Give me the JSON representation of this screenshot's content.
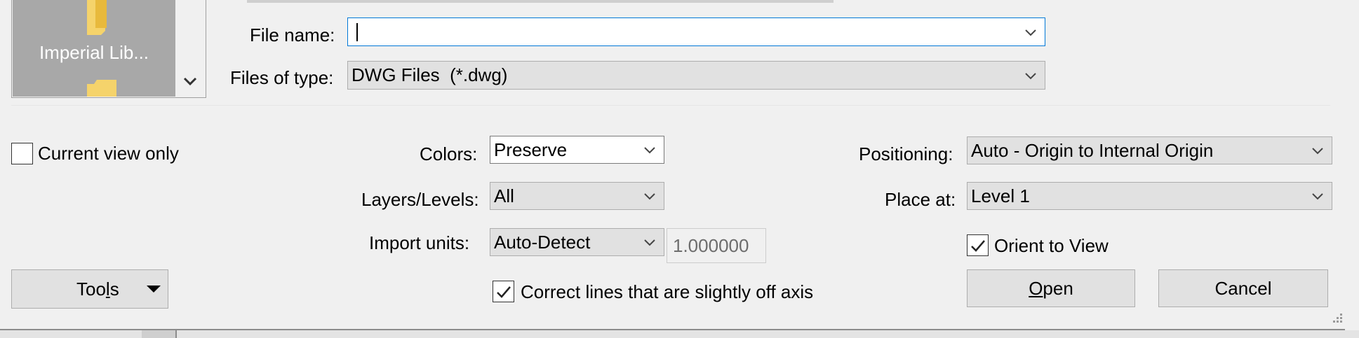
{
  "places_panel": {
    "item_label": "Imperial Lib...",
    "scroll_down_icon": "chevron-down-icon",
    "folder_icon": "folder-icon"
  },
  "file_name": {
    "label": "File name:",
    "value": ""
  },
  "files_of_type": {
    "label": "Files of type:",
    "value": "DWG Files  (*.dwg)"
  },
  "current_view_only": {
    "label": "Current view only",
    "checked": false
  },
  "colors": {
    "label": "Colors:",
    "value": "Preserve"
  },
  "layers_levels": {
    "label": "Layers/Levels:",
    "value": "All"
  },
  "import_units": {
    "label": "Import units:",
    "value": "Auto-Detect",
    "scale": "1.000000"
  },
  "correct_lines": {
    "label": "Correct lines that are slightly off axis",
    "checked": true
  },
  "positioning": {
    "label": "Positioning:",
    "value": "Auto - Origin to Internal Origin"
  },
  "place_at": {
    "label": "Place at:",
    "value": "Level 1"
  },
  "orient_to_view": {
    "label": "Orient to View",
    "checked": true
  },
  "buttons": {
    "tools": "Tools",
    "open": "Open",
    "cancel": "Cancel"
  },
  "colors_theme": {
    "focus_border": "#0078d7",
    "button_face": "#e1e1e1",
    "dialog_bg": "#f0f0f0"
  }
}
